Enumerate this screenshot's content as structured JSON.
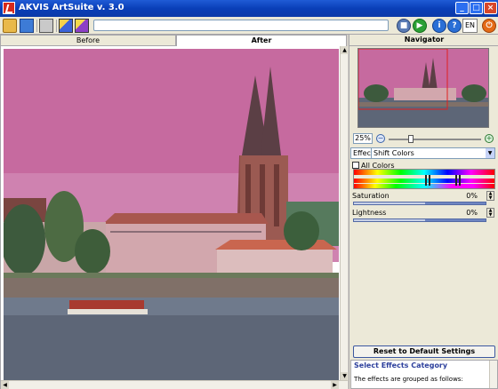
{
  "window": {
    "title": "AKVIS ArtSuite v. 3.0",
    "min": "_",
    "max": "□",
    "close": "×"
  },
  "toolbar": {
    "language": "EN",
    "icons": [
      "open-icon",
      "save-icon",
      "print-icon",
      "brush-icon",
      "magic-wand-icon",
      "stop-icon",
      "run-icon",
      "info-icon",
      "help-icon",
      "power-icon"
    ]
  },
  "tabs": {
    "before": "Before",
    "after": "After"
  },
  "navigator": {
    "title": "Navigator",
    "zoom": "25%",
    "zoom_level": 0.25
  },
  "effects": {
    "category": "Effects",
    "effect": "Shift Colors",
    "all_colors": "All Colors"
  },
  "params": [
    {
      "label": "Saturation",
      "value": "0%"
    },
    {
      "label": "Lightness",
      "value": "0%"
    }
  ],
  "buttons": {
    "reset": "Reset to Default Settings"
  },
  "help": {
    "title": "Select Effects Category",
    "text": "The effects are grouped as follows:"
  },
  "colors": {
    "titlebar": "#0a3fb8",
    "photo_tint": "#c66a9f",
    "panel": "#ece9d8"
  }
}
